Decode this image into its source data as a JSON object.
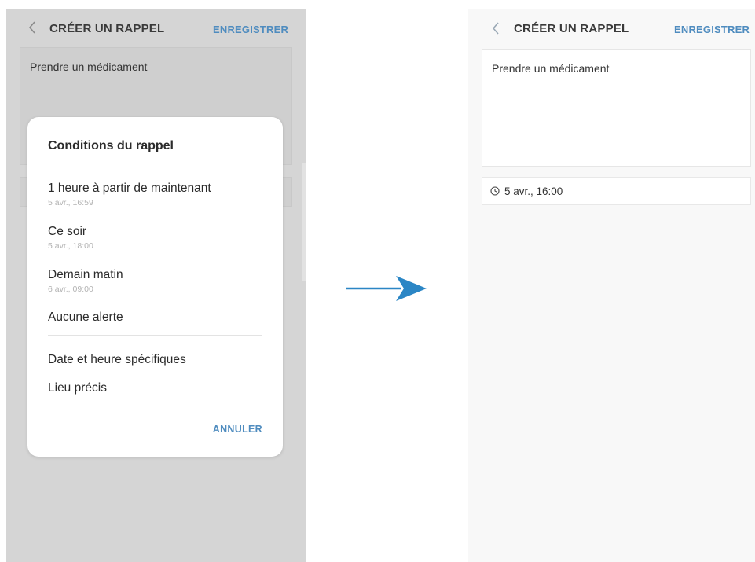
{
  "left_screen": {
    "title": "CRÉER UN RAPPEL",
    "save_label": "ENREGISTRER",
    "note_text": "Prendre un médicament",
    "dialog": {
      "title": "Conditions du rappel",
      "options": [
        {
          "label": "1 heure à partir de maintenant",
          "sub": "5 avr., 16:59"
        },
        {
          "label": "Ce soir",
          "sub": "5 avr., 18:00"
        },
        {
          "label": "Demain matin",
          "sub": "6 avr., 09:00"
        },
        {
          "label": "Aucune alerte",
          "sub": ""
        },
        {
          "label": "Date et heure spécifiques",
          "sub": ""
        },
        {
          "label": "Lieu précis",
          "sub": ""
        }
      ],
      "cancel_label": "ANNULER"
    }
  },
  "right_screen": {
    "title": "CRÉER UN RAPPEL",
    "save_label": "ENREGISTRER",
    "note_text": "Prendre un médicament",
    "reminder_time": "5 avr., 16:00"
  },
  "icons": {
    "back": "chevron-left-icon",
    "clock": "clock-icon",
    "transition": "arrow-right-icon"
  },
  "colors": {
    "accent": "#4f8cbf",
    "arrow": "#2b86c5",
    "dim_overlay": "#d5d5d5"
  }
}
